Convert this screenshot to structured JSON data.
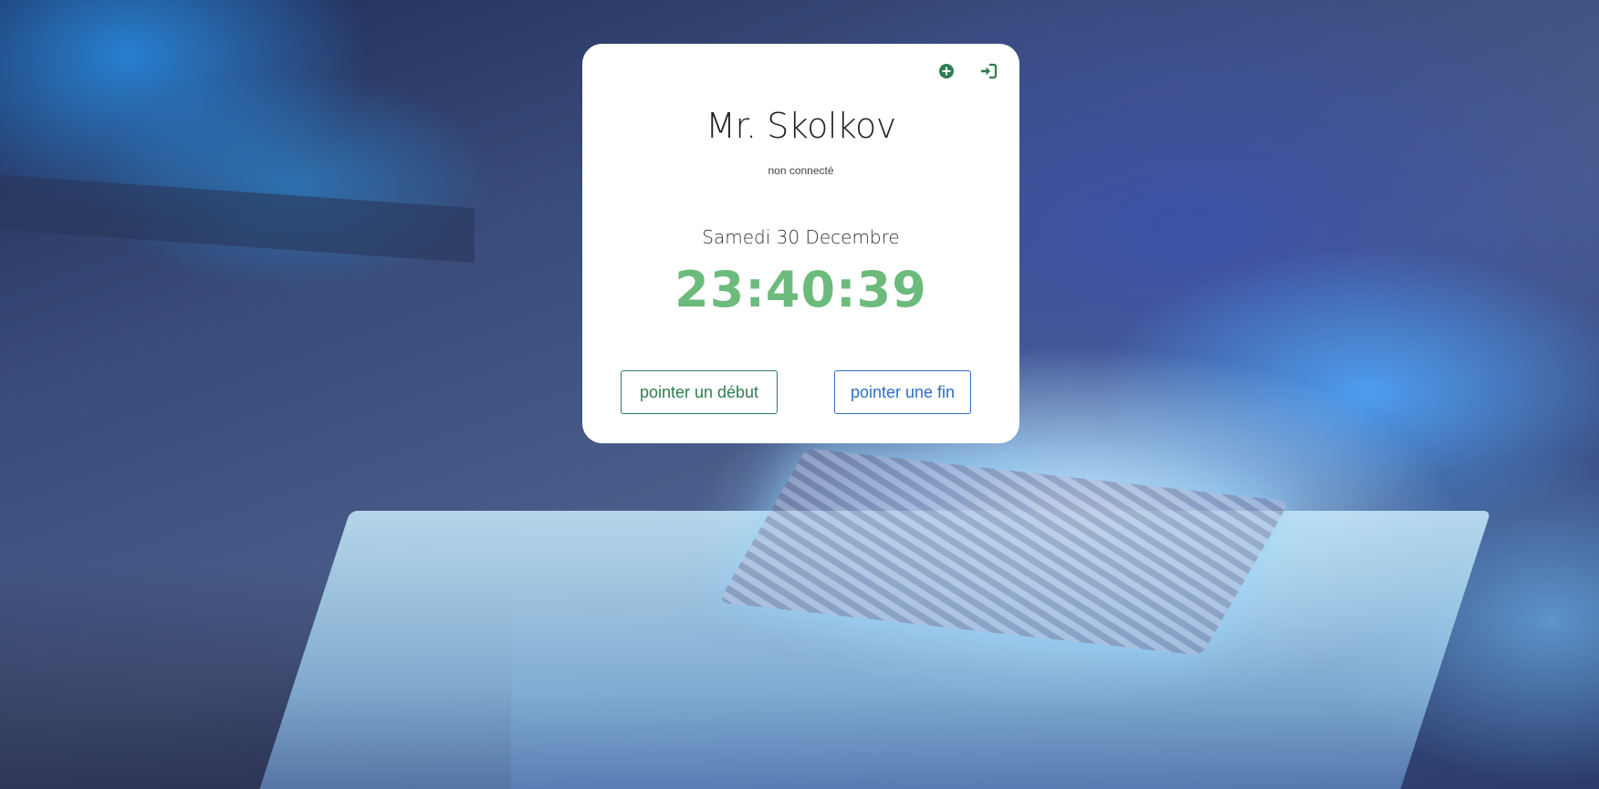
{
  "user": {
    "name": "Mr. Skolkov",
    "status": "non connecté"
  },
  "clock": {
    "date": "Samedi 30 Decembre",
    "time": "23:40:39"
  },
  "actions": {
    "start_label": "pointer un début",
    "end_label": "pointer une fin"
  },
  "icons": {
    "add": "plus-circle-icon",
    "login": "sign-in-icon"
  },
  "colors": {
    "accent_green": "#6cbb7c",
    "dark_green": "#2f7d52",
    "blue": "#2f6ec4"
  }
}
